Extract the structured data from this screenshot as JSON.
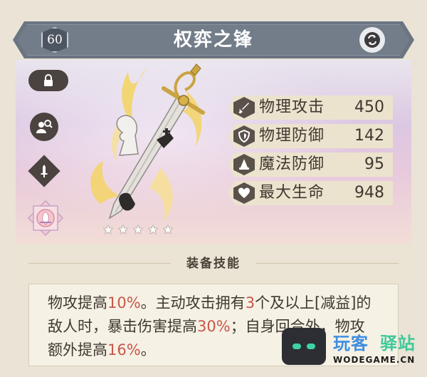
{
  "header": {
    "level": "60",
    "title": "权弈之锋"
  },
  "sidebar": {
    "lock_icon": "lock-icon",
    "inspect_icon": "magnify-user-icon",
    "weapon_type_icon": "sword-icon",
    "emblem_icon": "lotus-emblem-icon"
  },
  "weapon": {
    "rarity_stars": 5,
    "star_glyph": "★"
  },
  "stats": [
    {
      "icon": "sword-icon",
      "label": "物理攻击",
      "value": "450"
    },
    {
      "icon": "shield-icon",
      "label": "物理防御",
      "value": "142"
    },
    {
      "icon": "wizard-hat-icon",
      "label": "魔法防御",
      "value": "95"
    },
    {
      "icon": "heart-icon",
      "label": "最大生命",
      "value": "948"
    }
  ],
  "skill": {
    "header": "装备技能",
    "desc_parts": [
      {
        "text": "物攻提高",
        "hl": false
      },
      {
        "text": "10%",
        "hl": true
      },
      {
        "text": "。主动攻击拥有",
        "hl": false
      },
      {
        "text": "3",
        "hl": true
      },
      {
        "text": "个及以上[减益]的敌人时，暴击伤害提高",
        "hl": false
      },
      {
        "text": "30%",
        "hl": true
      },
      {
        "text": "；自身回合外，物攻额外提高",
        "hl": false
      },
      {
        "text": "16%",
        "hl": true
      },
      {
        "text": "。",
        "hl": false
      }
    ]
  },
  "watermark": {
    "name_part1": "玩客",
    "name_part2": "驿站",
    "url": "WODEGAME.CN"
  },
  "colors": {
    "banner": "#6b7582",
    "highlight": "#c9564a",
    "icon_dark": "#4a4340",
    "stat_bg": "#ece3ce",
    "gold": "#f1c94a"
  }
}
